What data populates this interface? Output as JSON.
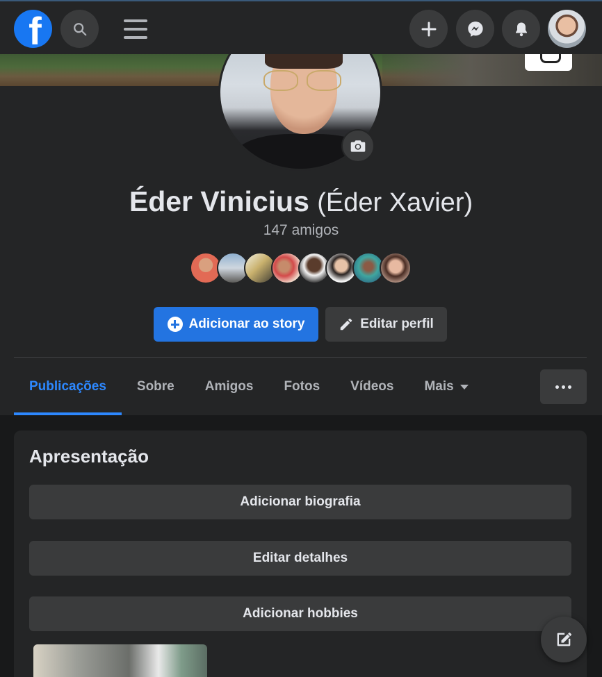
{
  "nav": {
    "logo_letter": "f",
    "icons": [
      "search-icon",
      "hamburger-menu-icon",
      "plus-icon",
      "messenger-icon",
      "bell-icon"
    ]
  },
  "profile": {
    "name": "Éder Vinicius",
    "alternate_name": "(Éder Xavier)",
    "friends_count": "147 amigos"
  },
  "actions": {
    "add_story": "Adicionar ao story",
    "edit_profile": "Editar perfil"
  },
  "tabs": [
    {
      "label": "Publicações",
      "active": true
    },
    {
      "label": "Sobre",
      "active": false
    },
    {
      "label": "Amigos",
      "active": false
    },
    {
      "label": "Fotos",
      "active": false
    },
    {
      "label": "Vídeos",
      "active": false
    },
    {
      "label": "Mais",
      "active": false
    }
  ],
  "intro": {
    "title": "Apresentação",
    "add_bio": "Adicionar biografia",
    "edit_details": "Editar detalhes",
    "add_hobbies": "Adicionar hobbies"
  },
  "colors": {
    "accent": "#2d88ff",
    "primary_button": "#2374e1",
    "surface": "#242526",
    "background": "#18191a"
  }
}
